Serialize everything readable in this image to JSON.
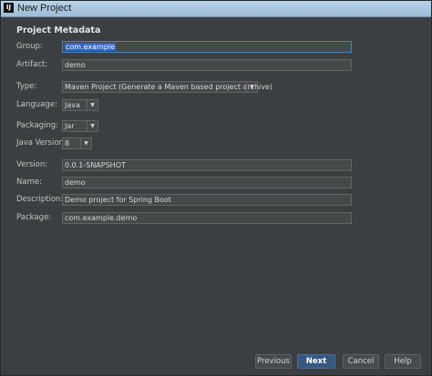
{
  "window": {
    "title": "New Project",
    "app_icon": "IJ"
  },
  "section_title": "Project Metadata",
  "fields": {
    "group": {
      "label": "Group:",
      "value": "com.example"
    },
    "artifact": {
      "label": "Artifact:",
      "value": "demo"
    },
    "type": {
      "label": "Type:",
      "value": "Maven Project (Generate a Maven based project archive)"
    },
    "language": {
      "label": "Language:",
      "value": "Java"
    },
    "packaging": {
      "label": "Packaging:",
      "value": "Jar"
    },
    "java_version": {
      "label": "Java Version:",
      "value": "8"
    },
    "version": {
      "label": "Version:",
      "value": "0.0.1-SNAPSHOT"
    },
    "name": {
      "label": "Name:",
      "value": "demo"
    },
    "description": {
      "label": "Description:",
      "value": "Demo project for Spring Boot"
    },
    "package": {
      "label": "Package:",
      "value": "com.example.demo"
    }
  },
  "buttons": {
    "previous": "Previous",
    "next": "Next",
    "cancel": "Cancel",
    "help": "Help"
  },
  "icons": {
    "dropdown": "chevron-down-icon",
    "app": "intellij-app-icon"
  },
  "colors": {
    "background": "#3c3f41",
    "accent": "#365880",
    "selection": "#2f65ca"
  }
}
